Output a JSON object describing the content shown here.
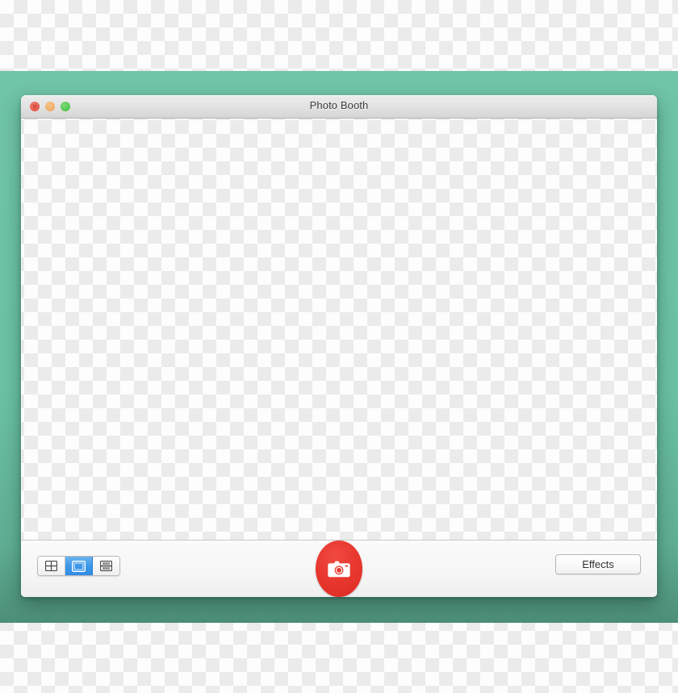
{
  "window": {
    "title": "Photo Booth",
    "controls": {
      "close": "close-button",
      "minimize": "minimize-button",
      "maximize": "maximize-button"
    }
  },
  "preview": {
    "content": "",
    "description": "empty transparent preview area"
  },
  "toolbar": {
    "view_modes": [
      {
        "name": "four-up-grid",
        "label": "4-up photo grid",
        "selected": false
      },
      {
        "name": "single-photo",
        "label": "Single photo",
        "selected": true
      },
      {
        "name": "movie-clip",
        "label": "Movie clip",
        "selected": false
      }
    ],
    "shutter": {
      "name": "camera-shutter",
      "label": "Take Photo"
    },
    "effects_label": "Effects"
  },
  "colors": {
    "desktop_green": "#6bc1a3",
    "shutter_red": "#e2332b",
    "selection_blue": "#3f98e8",
    "titlebar_gray": "#e3e3e3",
    "toolbar_gray": "#f6f6f6"
  }
}
